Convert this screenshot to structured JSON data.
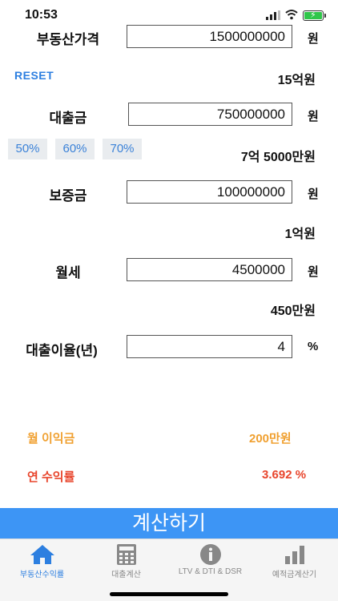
{
  "status": {
    "time": "10:53"
  },
  "inputs": {
    "price": {
      "label": "부동산가격",
      "value": "1500000000",
      "unit": "원",
      "result": "15억원"
    },
    "loan": {
      "label": "대출금",
      "value": "750000000",
      "unit": "원",
      "result": "7억 5000만원"
    },
    "deposit": {
      "label": "보증금",
      "value": "100000000",
      "unit": "원",
      "result": "1억원"
    },
    "rent": {
      "label": "월세",
      "value": "4500000",
      "unit": "원",
      "result": "450만원"
    },
    "rate": {
      "label": "대출이율(년)",
      "value": "4",
      "unit": "%"
    }
  },
  "reset_label": "RESET",
  "ratio_buttons": [
    "50%",
    "60%",
    "70%"
  ],
  "summary": {
    "monthly_label": "월 이익금",
    "monthly_value": "200만원",
    "yearly_label": "연 수익률",
    "yearly_value": "3.692 %"
  },
  "calc_button": "계산하기",
  "tabs": [
    {
      "label": "부동산수익률",
      "icon": "home-icon",
      "active": true
    },
    {
      "label": "대출계산",
      "icon": "calculator-icon",
      "active": false
    },
    {
      "label": "LTV & DTI & DSR",
      "icon": "info-icon",
      "active": false
    },
    {
      "label": "예적금계산기",
      "icon": "bar-chart-icon",
      "active": false
    }
  ],
  "colors": {
    "accent": "#2d7fe0",
    "button": "#3d95f5",
    "monthly": "#f0a030",
    "yearly": "#e8452c",
    "battery": "#2fc64a"
  }
}
